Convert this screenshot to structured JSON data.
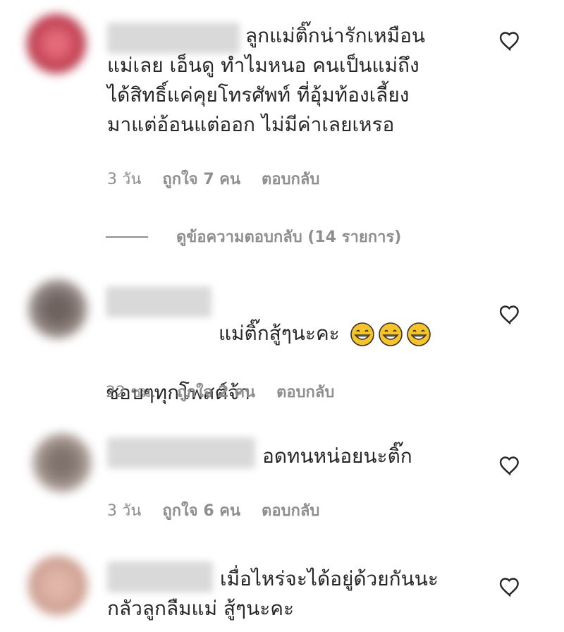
{
  "comments": [
    {
      "text": "ลูกแม่ติ๊กน่ารักเหมือน\nแม่เลย เอ็นดู ทำไมหนอ คนเป็นแม่ถึง\nได้สิทธิ์แค่คุยโทรศัพท์ ที่อุ้มท้องเลี้ยง\nมาแต่อ้อนแต่ออก ไม่มีค่าเลยเหรอ",
      "time": "3 วัน",
      "likes": "ถูกใจ 7 คน",
      "reply": "ตอบกลับ",
      "avatar_color": "#c2404e"
    },
    {
      "text": "แม่ติ๊กสู้ๆนะคะ",
      "text2": "ชอบๆทุกโพสต์จ้า",
      "emoji": "grinning-face-with-smiling-eyes",
      "time": "22 ชม.",
      "likes": "ถูกใจ 2 คน",
      "reply": "ตอบกลับ",
      "avatar_color": "#8a7d78"
    },
    {
      "text": "อดทนหน่อยนะติ๊ก",
      "time": "3 วัน",
      "likes": "ถูกใจ 6 คน",
      "reply": "ตอบกลับ",
      "avatar_color": "#9a8a82"
    },
    {
      "text": "เมื่อไหร่จะได้อยู่ด้วยกันนะ\nกลัวลูกลืมแม่ สู้ๆนะคะ",
      "avatar_color": "#d3a79a"
    }
  ],
  "view_replies": "ดูข้อความตอบกลับ (14 รายการ)",
  "icons": {
    "like": "heart-outline-icon",
    "emoji": "grinning-face-emoji"
  },
  "colors": {
    "text": "#262626",
    "muted": "#8e8e8e",
    "emoji": "#f7c325"
  }
}
